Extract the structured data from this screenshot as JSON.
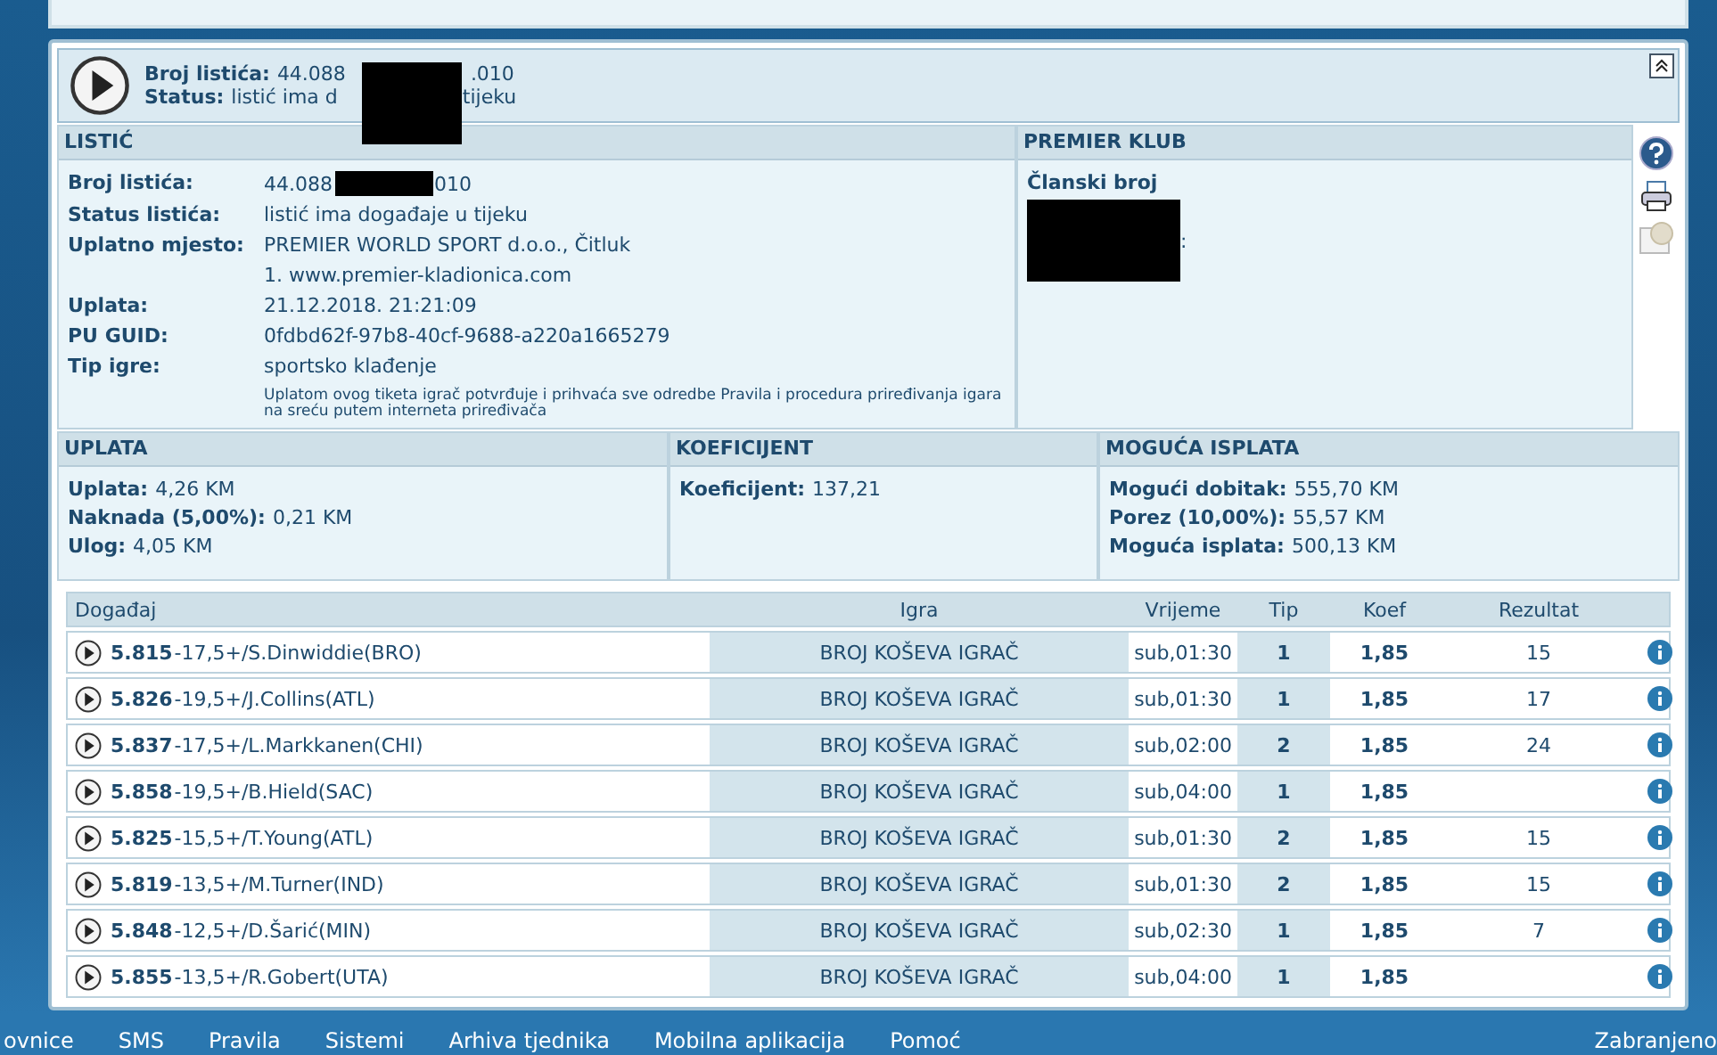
{
  "ticket_header": {
    "number_label": "Broj listića:",
    "number_parts": [
      "44.088",
      ".010"
    ],
    "status_label": "Status:",
    "status_parts": [
      "listić ima d",
      "tijeku"
    ]
  },
  "listic": {
    "title": "LISTIĆ",
    "rows": [
      {
        "label": "Broj listića:",
        "parts": [
          "44.088",
          "010"
        ]
      },
      {
        "label": "Status listića:",
        "parts": [
          "listić ima događaje u tijeku"
        ]
      },
      {
        "label": "Uplatno mjesto:",
        "parts": [
          "PREMIER WORLD SPORT d.o.o., Čitluk"
        ]
      },
      {
        "label": "",
        "parts": [
          "1. www.premier-kladionica.com"
        ]
      },
      {
        "label": "Uplata:",
        "parts": [
          "21.12.2018. 21:21:09"
        ]
      },
      {
        "label": "PU GUID:",
        "parts": [
          "0fdbd62f-97b8-40cf-9688-a220a1665279"
        ]
      },
      {
        "label": "Tip igre:",
        "parts": [
          "sportsko klađenje"
        ]
      }
    ],
    "notice": "Uplatom ovog tiketa igrač potvrđuje i prihvaća sve odredbe Pravila i procedura priređivanja igara na sreću putem interneta priređivača"
  },
  "premier_klub": {
    "title": "PREMIER KLUB",
    "label": "Članski broj",
    "value_tail": ":"
  },
  "summary": [
    {
      "title": "UPLATA",
      "lines": [
        {
          "label": "Uplata:",
          "value": "4,26 KM"
        },
        {
          "label": "Naknada (5,00%):",
          "value": "0,21 KM"
        },
        {
          "label": "Ulog:",
          "value": "4,05 KM"
        }
      ]
    },
    {
      "title": "KOEFICIJENT",
      "lines": [
        {
          "label": "Koeficijent:",
          "value": "137,21"
        }
      ]
    },
    {
      "title": "MOGUĆA ISPLATA",
      "lines": [
        {
          "label": "Mogući dobitak:",
          "value": "555,70 KM"
        },
        {
          "label": "Porez (10,00%):",
          "value": "55,57 KM"
        },
        {
          "label": "Moguća isplata:",
          "value": "500,13 KM"
        }
      ]
    }
  ],
  "events": {
    "columns": [
      "Događaj",
      "Igra",
      "Vrijeme",
      "Tip",
      "Koef",
      "Rezultat"
    ],
    "rows": [
      {
        "code": "5.815",
        "name": "-17,5+/S.Dinwiddie(BRO)",
        "game": "BROJ KOŠEVA IGRAČ",
        "time": "sub,01:30",
        "tip": "1",
        "odds": "1,85",
        "result": "15"
      },
      {
        "code": "5.826",
        "name": "-19,5+/J.Collins(ATL)",
        "game": "BROJ KOŠEVA IGRAČ",
        "time": "sub,01:30",
        "tip": "1",
        "odds": "1,85",
        "result": "17"
      },
      {
        "code": "5.837",
        "name": "-17,5+/L.Markkanen(CHI)",
        "game": "BROJ KOŠEVA IGRAČ",
        "time": "sub,02:00",
        "tip": "2",
        "odds": "1,85",
        "result": "24"
      },
      {
        "code": "5.858",
        "name": "-19,5+/B.Hield(SAC)",
        "game": "BROJ KOŠEVA IGRAČ",
        "time": "sub,04:00",
        "tip": "1",
        "odds": "1,85"
      },
      {
        "code": "5.825",
        "name": "-15,5+/T.Young(ATL)",
        "game": "BROJ KOŠEVA IGRAČ",
        "time": "sub,01:30",
        "tip": "2",
        "odds": "1,85",
        "result": "15"
      },
      {
        "code": "5.819",
        "name": "-13,5+/M.Turner(IND)",
        "game": "BROJ KOŠEVA IGRAČ",
        "time": "sub,01:30",
        "tip": "2",
        "odds": "1,85",
        "result": "15"
      },
      {
        "code": "5.848",
        "name": "-12,5+/D.Šarić(MIN)",
        "game": "BROJ KOŠEVA IGRAČ",
        "time": "sub,02:30",
        "tip": "1",
        "odds": "1,85",
        "result": "7"
      },
      {
        "code": "5.855",
        "name": "-13,5+/R.Gobert(UTA)",
        "game": "BROJ KOŠEVA IGRAČ",
        "time": "sub,04:00",
        "tip": "1",
        "odds": "1,85"
      }
    ]
  },
  "nav": [
    "ovnice",
    "SMS",
    "Pravila",
    "Sistemi",
    "Arhiva tjednika",
    "Mobilna aplikacija",
    "Pomoć"
  ],
  "nav_right": "Zabranjeno"
}
